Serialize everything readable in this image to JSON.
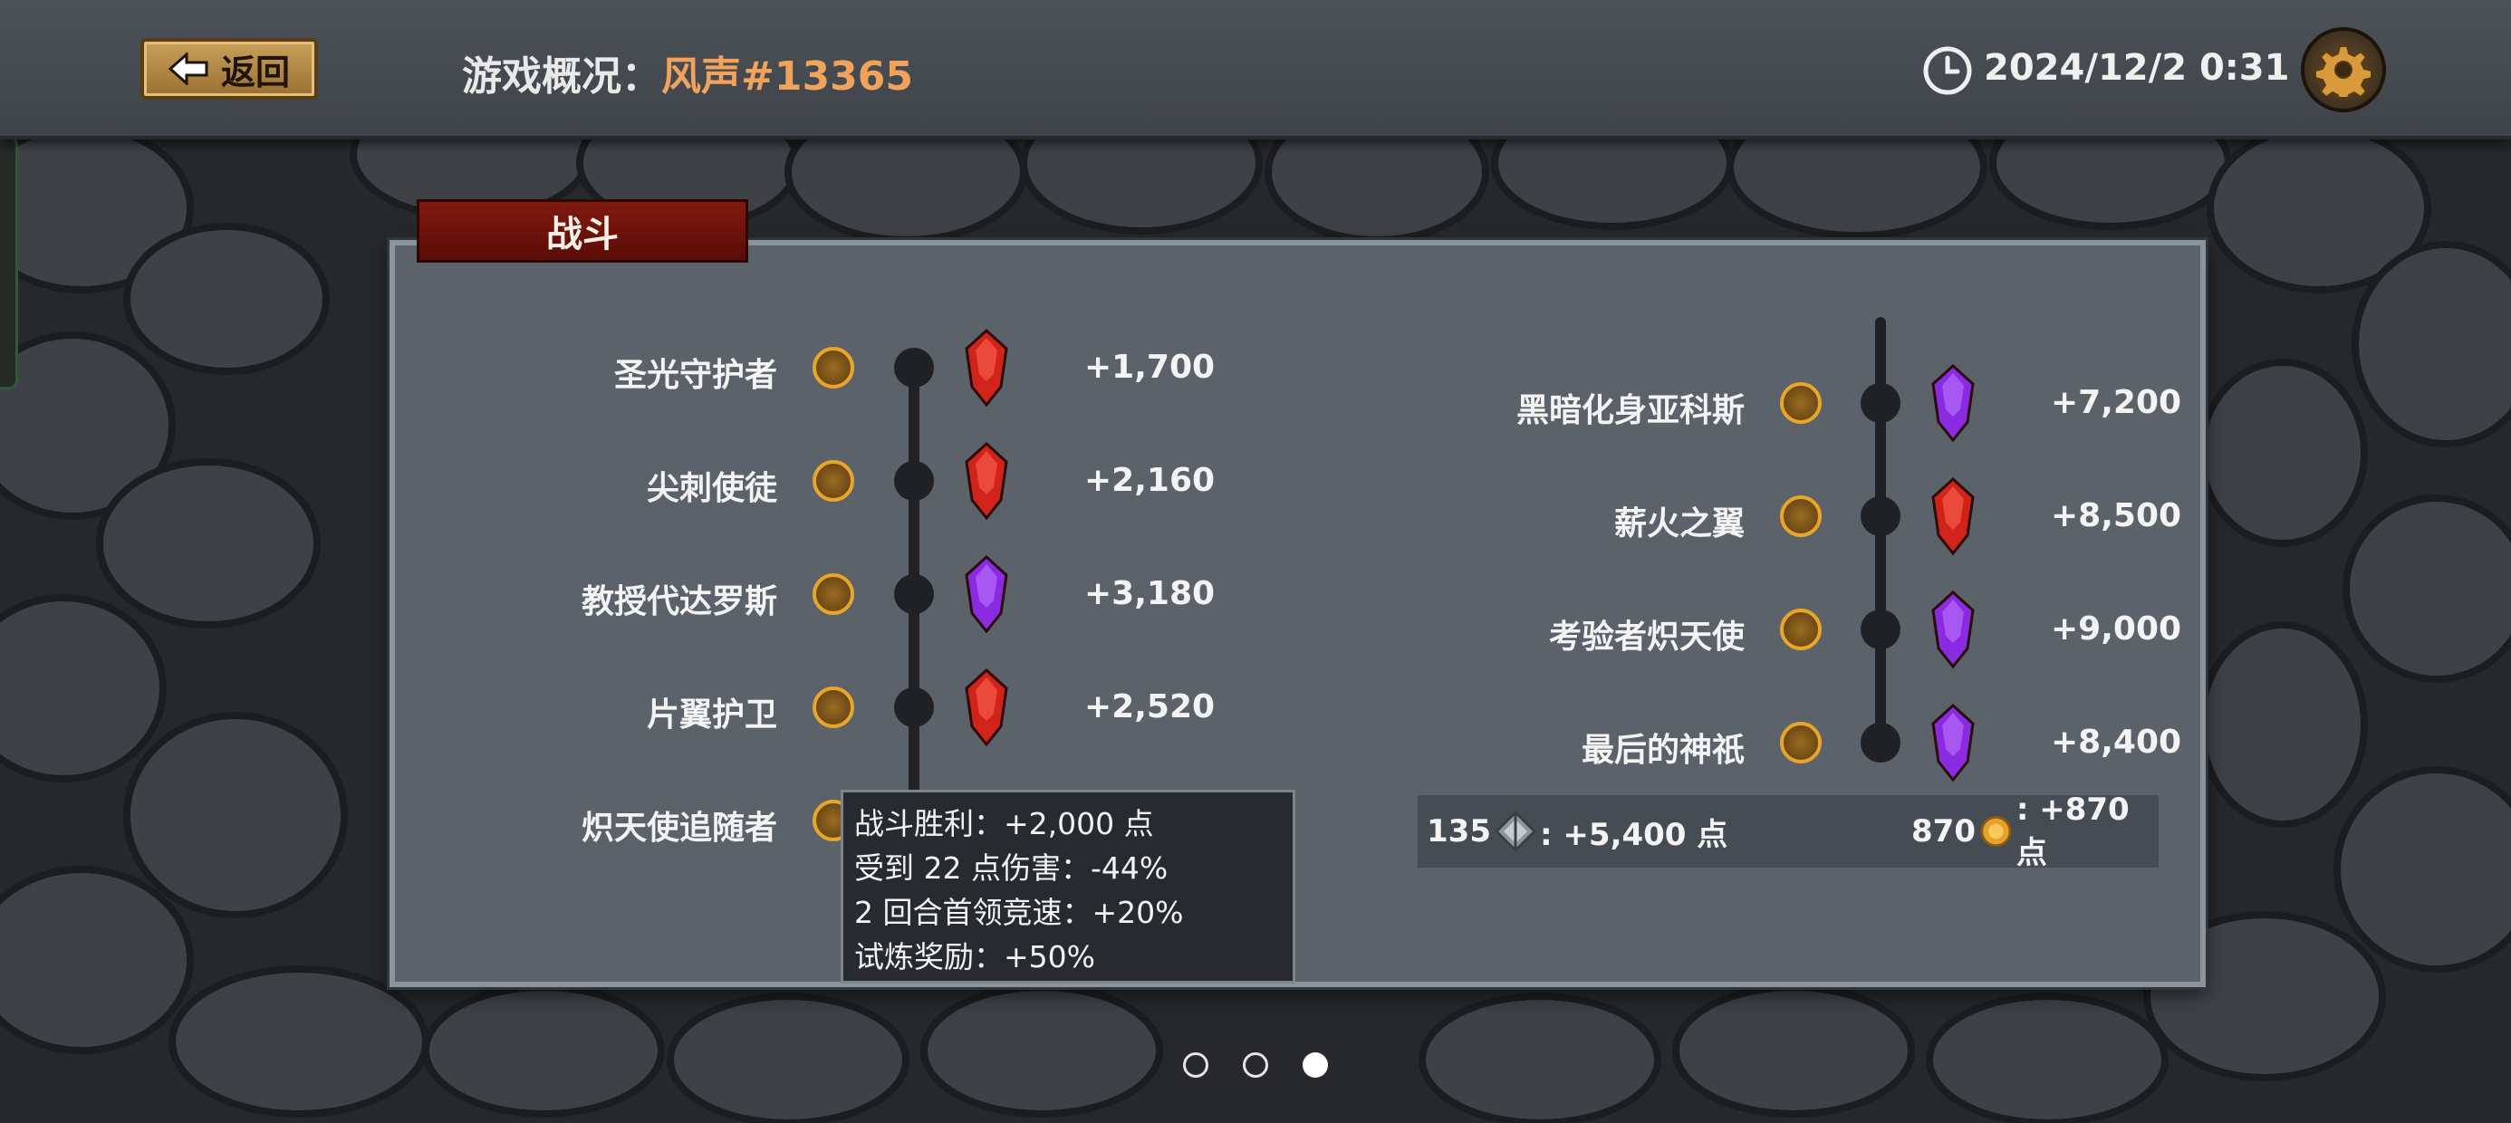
{
  "header": {
    "back_label": "返回",
    "title_label": "游戏概况：",
    "title_value": "风声#13365",
    "datetime": "2024/12/2 0:31"
  },
  "panel": {
    "tab_label": "战斗",
    "left_bosses": [
      {
        "name": "圣光守护者",
        "gem": "red",
        "reward": "+1,700"
      },
      {
        "name": "尖刺使徒",
        "gem": "red",
        "reward": "+2,160"
      },
      {
        "name": "教授代达罗斯",
        "gem": "purple",
        "reward": "+3,180"
      },
      {
        "name": "片翼护卫",
        "gem": "red",
        "reward": "+2,520"
      },
      {
        "name": "炽天使追随者",
        "gem": "",
        "reward": ""
      }
    ],
    "right_bosses": [
      {
        "name": "黑暗化身亚科斯",
        "gem": "purple",
        "reward": "+7,200"
      },
      {
        "name": "薪火之翼",
        "gem": "red",
        "reward": "+8,500"
      },
      {
        "name": "考验者炽天使",
        "gem": "purple",
        "reward": "+9,000"
      },
      {
        "name": "最后的神祇",
        "gem": "purple",
        "reward": "+8,400"
      }
    ],
    "summary": {
      "shard_count": "135",
      "shard_points": ": +5,400 点",
      "coin_count": "870",
      "coin_points": ": +870 点"
    }
  },
  "tooltip": {
    "lines": [
      "战斗胜利：+2,000 点",
      "受到 22 点伤害：-44%",
      "2 回合首领竞速：+20%",
      "试炼奖励：+50%"
    ]
  },
  "pager": {
    "count": 3,
    "active": 3
  },
  "colors": {
    "accent_orange": "#f2a35b",
    "tab_red": "#6b1209",
    "gem_red": "#d0231a",
    "gem_purple": "#8a2be2",
    "icon_gold": "#e7a628"
  },
  "icons": {
    "back": "arrow-left-icon",
    "clock": "clock-icon",
    "settings": "gear-icon",
    "shard": "crystal-shard-icon",
    "coin": "gold-coin-icon"
  }
}
